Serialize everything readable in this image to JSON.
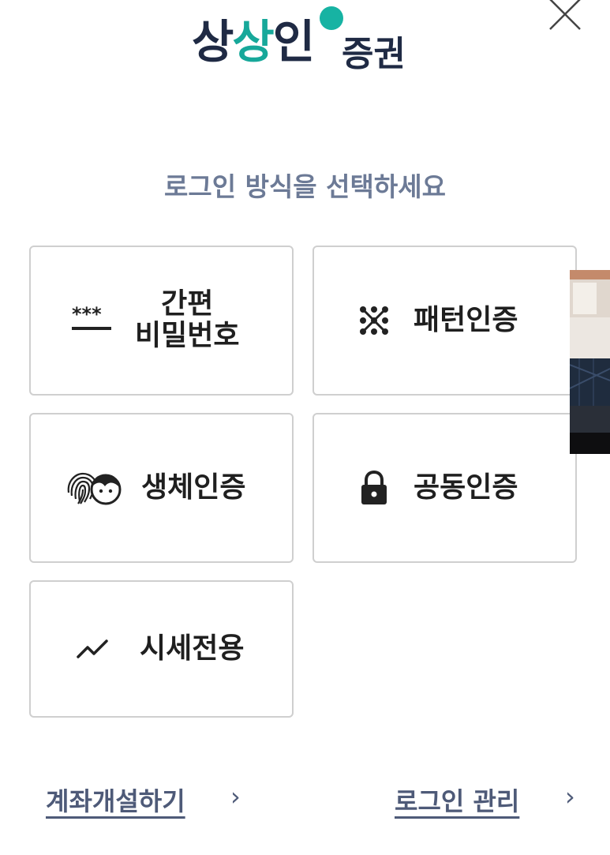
{
  "logo": {
    "part1": "상",
    "part2": "상",
    "part3": "인",
    "suffix": "증권",
    "accent_color": "#17b3a3",
    "text_color": "#1f2a44"
  },
  "close_icon": "close-icon",
  "subtitle": "로그인 방식을 선택하세요",
  "login_options": {
    "simple_pin": {
      "line1": "간편",
      "line2": "비밀번호",
      "icon": "asterisk-password-icon"
    },
    "pattern": {
      "label": "패턴인증",
      "icon": "pattern-dots-icon"
    },
    "biometric": {
      "label": "생체인증",
      "icon": "fingerprint-face-icon"
    },
    "certificate": {
      "label": "공동인증",
      "icon": "lock-icon"
    },
    "market_only": {
      "label": "시세전용",
      "icon": "trend-line-icon"
    }
  },
  "footer": {
    "open_account": "계좌개설하기",
    "login_manage": "로그인 관리",
    "chevron": "›"
  },
  "colors": {
    "subtitle": "#6c7a96",
    "card_border": "#cfcfcf",
    "footer_link": "#4e5a78"
  }
}
